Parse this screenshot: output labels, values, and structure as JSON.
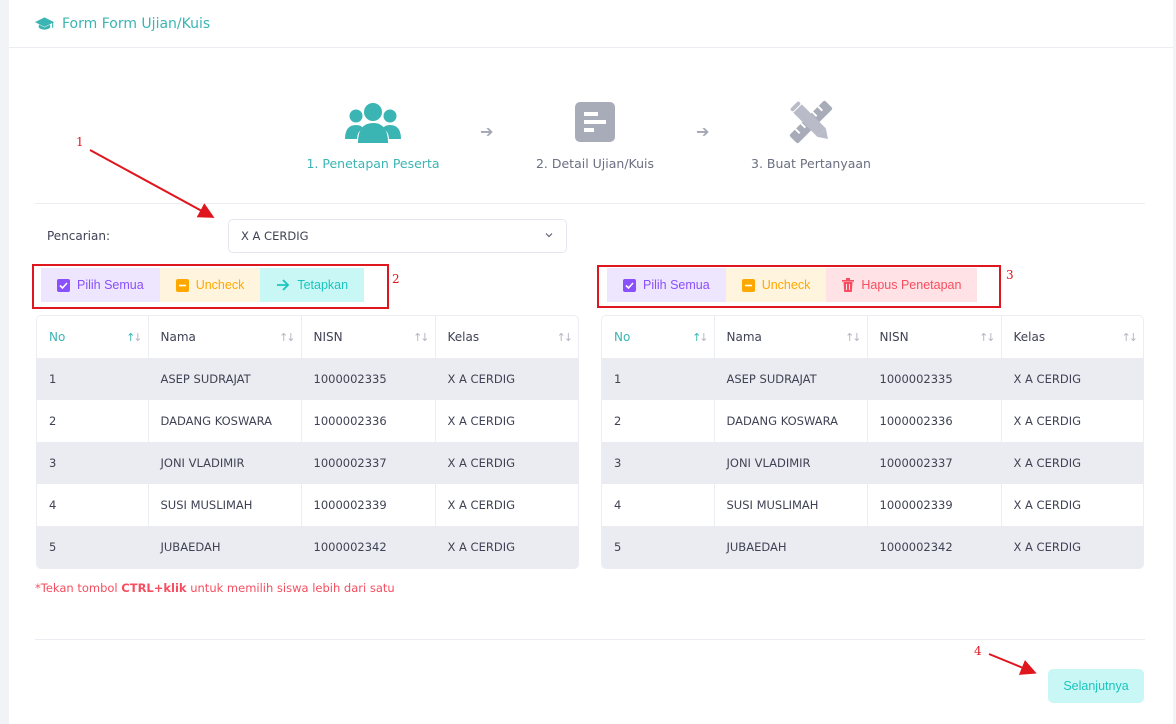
{
  "header": {
    "title": "Form Form Ujian/Kuis",
    "icon": "graduation-cap-icon"
  },
  "steps": [
    {
      "label": "1. Penetapan Peserta",
      "icon": "users-icon",
      "active": true
    },
    {
      "label": "2. Detail Ujian/Kuis",
      "icon": "document-icon",
      "active": false
    },
    {
      "label": "3. Buat Pertanyaan",
      "icon": "pencil-ruler-icon",
      "active": false
    }
  ],
  "search": {
    "label": "Pencarian:",
    "value": "X A CERDIG"
  },
  "left_actions": {
    "select_all": "Pilih Semua",
    "uncheck": "Uncheck",
    "assign": "Tetapkan"
  },
  "right_actions": {
    "select_all": "Pilih Semua",
    "uncheck": "Uncheck",
    "remove": "Hapus Penetapan"
  },
  "table_columns": [
    "No",
    "Nama",
    "NISN",
    "Kelas"
  ],
  "left_table": [
    [
      "1",
      "ASEP SUDRAJAT",
      "1000002335",
      "X A CERDIG"
    ],
    [
      "2",
      "DADANG KOSWARA",
      "1000002336",
      "X A CERDIG"
    ],
    [
      "3",
      "JONI VLADIMIR",
      "1000002337",
      "X A CERDIG"
    ],
    [
      "4",
      "SUSI MUSLIMAH",
      "1000002339",
      "X A CERDIG"
    ],
    [
      "5",
      "JUBAEDAH",
      "1000002342",
      "X A CERDIG"
    ]
  ],
  "right_table": [
    [
      "1",
      "ASEP SUDRAJAT",
      "1000002335",
      "X A CERDIG"
    ],
    [
      "2",
      "DADANG KOSWARA",
      "1000002336",
      "X A CERDIG"
    ],
    [
      "3",
      "JONI VLADIMIR",
      "1000002337",
      "X A CERDIG"
    ],
    [
      "4",
      "SUSI MUSLIMAH",
      "1000002339",
      "X A CERDIG"
    ],
    [
      "5",
      "JUBAEDAH",
      "1000002342",
      "X A CERDIG"
    ]
  ],
  "note": {
    "prefix": "*Tekan tombol ",
    "key": "CTRL+klik",
    "suffix": " untuk memilih siswa lebih dari satu"
  },
  "next_button": "Selanjutnya",
  "annotations": [
    "1",
    "2",
    "3",
    "4"
  ],
  "colors": {
    "accent": "#3bb4b4",
    "annotation": "#e0161f",
    "purple": "#8950fc",
    "orange": "#ffa800",
    "teal": "#1bc5bd",
    "red": "#f64e60"
  }
}
